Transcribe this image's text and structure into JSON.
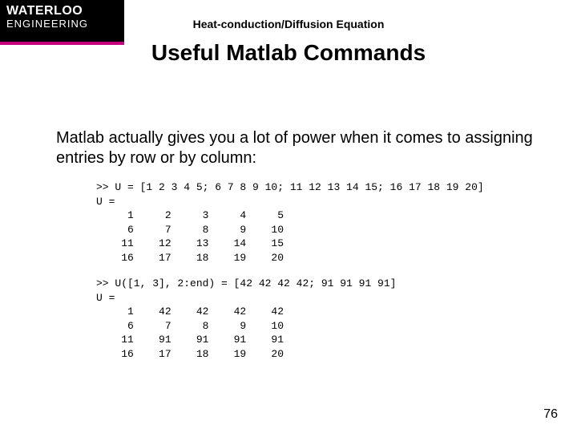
{
  "logo": {
    "line1": "WATERLOO",
    "line2": "ENGINEERING"
  },
  "header_topic": "Heat-conduction/Diffusion Equation",
  "title": "Useful Matlab Commands",
  "body": "Matlab actually gives you a lot of power when it comes to assigning entries by row or by column:",
  "code_block_1": ">> U = [1 2 3 4 5; 6 7 8 9 10; 11 12 13 14 15; 16 17 18 19 20]\nU =\n     1     2     3     4     5\n     6     7     8     9    10\n    11    12    13    14    15\n    16    17    18    19    20",
  "code_block_2": ">> U([1, 3], 2:end) = [42 42 42 42; 91 91 91 91]\nU =\n     1    42    42    42    42\n     6     7     8     9    10\n    11    91    91    91    91\n    16    17    18    19    20",
  "slide_number": "76"
}
